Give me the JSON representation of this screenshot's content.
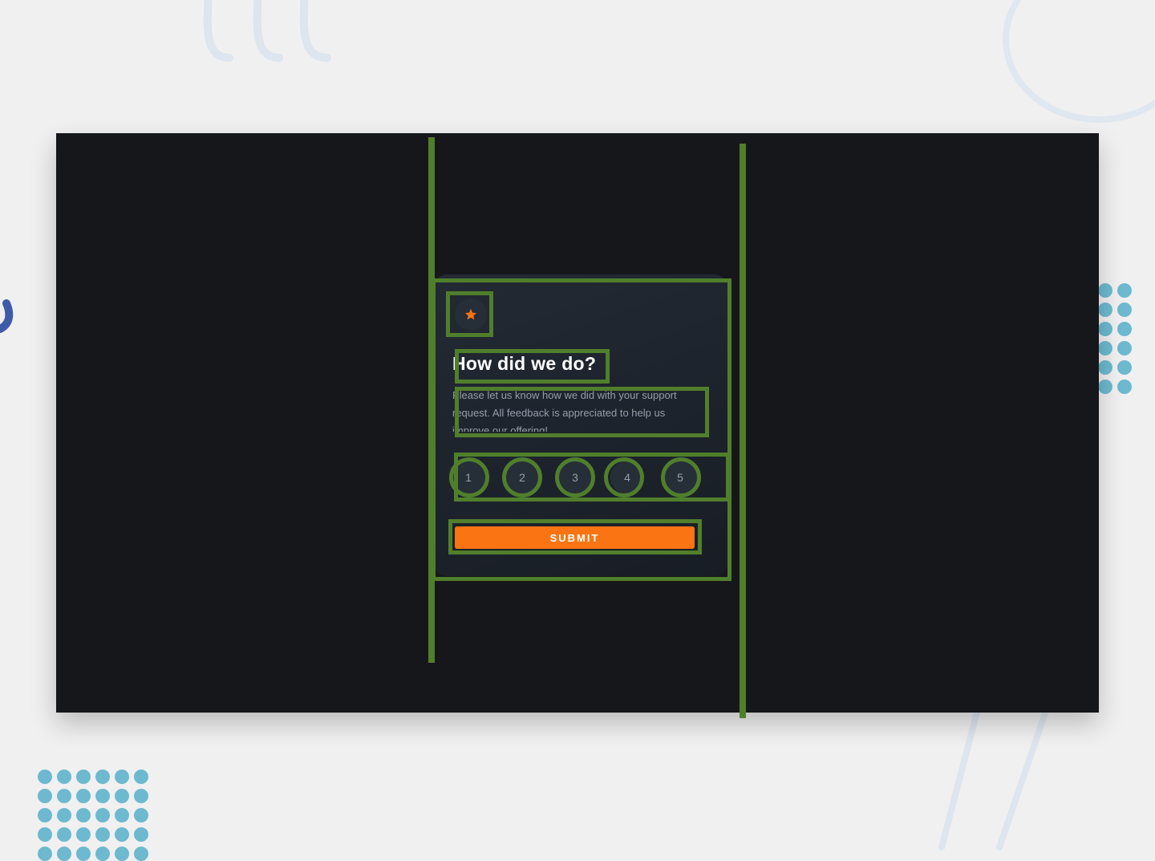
{
  "card": {
    "icon": "star-icon",
    "title": "How did we do?",
    "description": "Please let us know how we did with your support request. All feedback is appreciated to help us improve our offering!",
    "ratings": [
      "1",
      "2",
      "3",
      "4",
      "5"
    ],
    "submit_label": "SUBMIT"
  },
  "colors": {
    "page_background": "#f0f0f0",
    "screen_background": "#16171b",
    "card_background": "#1f252e",
    "accent_orange": "#fb7413",
    "rating_bubble": "#262e38",
    "annotation_green": "#507f2b",
    "dot_teal": "#6db9cf"
  }
}
